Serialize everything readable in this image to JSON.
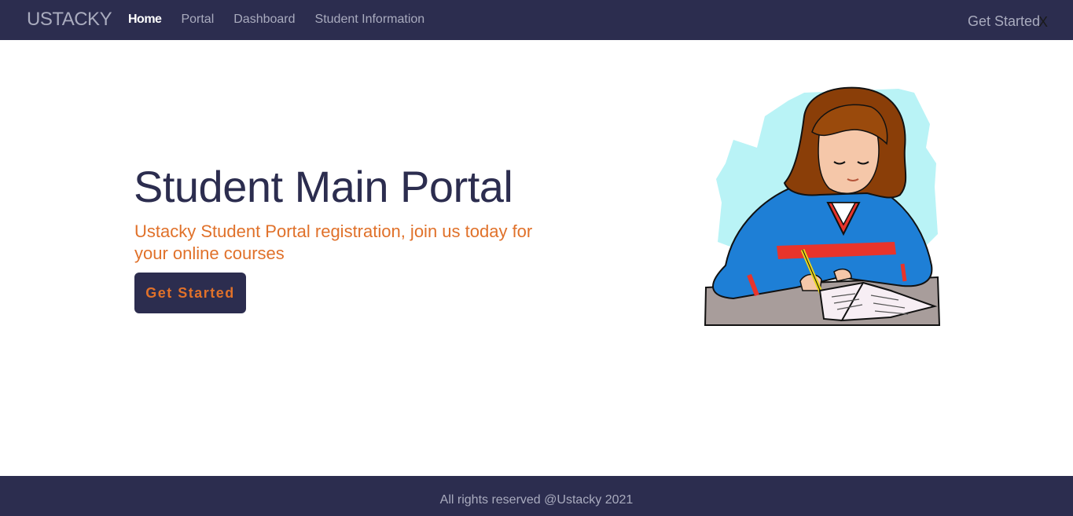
{
  "nav": {
    "brand": "USTACKY",
    "links": [
      {
        "label": "Home"
      },
      {
        "label": "Portal"
      },
      {
        "label": "Dashboard"
      },
      {
        "label": "Student Information"
      }
    ],
    "cta": "Get Started",
    "close": "X"
  },
  "hero": {
    "title": "Student Main Portal",
    "subtitle": "Ustacky Student Portal registration, join us today for your online courses",
    "button": "Get Started",
    "image_icon": "student-writing-illustration"
  },
  "footer": {
    "text": "All rights reserved @Ustacky 2021"
  },
  "colors": {
    "navy": "#2c2d4f",
    "accent": "#e0712a",
    "muted": "#a9abbe"
  }
}
